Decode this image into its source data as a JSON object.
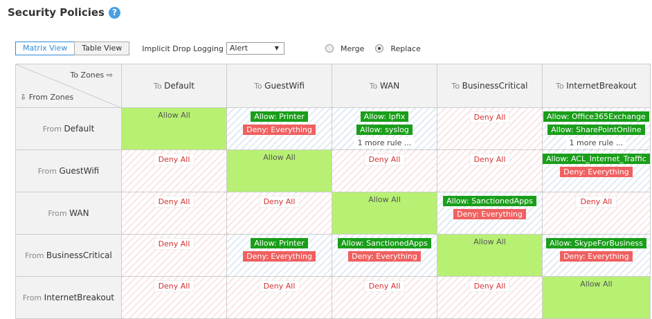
{
  "header": {
    "title": "Security Policies",
    "help_glyph": "?"
  },
  "toolbar": {
    "matrix_view": "Matrix View",
    "table_view": "Table View",
    "drop_logging_label": "Implicit Drop Logging",
    "drop_logging_value": "Alert",
    "merge_label": "Merge",
    "replace_label": "Replace",
    "selected_mode": "Replace"
  },
  "matrix": {
    "to_zones_label": "To Zones ⇨",
    "from_zones_label": "⇩  From Zones",
    "to_prefix": "To",
    "from_prefix": "From",
    "columns": [
      "Default",
      "GuestWifi",
      "WAN",
      "BusinessCritical",
      "InternetBreakout"
    ],
    "rows": [
      {
        "zone": "Default",
        "cells": [
          {
            "type": "allow-all",
            "label": "Allow All"
          },
          {
            "type": "mixed",
            "items": [
              {
                "kind": "allow",
                "text": "Allow: Printer"
              },
              {
                "kind": "deny",
                "text": "Deny: Everything"
              }
            ]
          },
          {
            "type": "mixed",
            "items": [
              {
                "kind": "allow",
                "text": "Allow: Ipfix"
              },
              {
                "kind": "allow",
                "text": "Allow: syslog"
              },
              {
                "kind": "more",
                "text": "1 more rule ..."
              }
            ]
          },
          {
            "type": "deny-all",
            "label": "Deny All"
          },
          {
            "type": "mixed",
            "items": [
              {
                "kind": "allow",
                "text": "Allow: Office365Exchange"
              },
              {
                "kind": "allow",
                "text": "Allow: SharePointOnline"
              },
              {
                "kind": "more",
                "text": "1 more rule ..."
              }
            ]
          }
        ]
      },
      {
        "zone": "GuestWifi",
        "cells": [
          {
            "type": "deny-all",
            "label": "Deny All"
          },
          {
            "type": "allow-all",
            "label": "Allow All"
          },
          {
            "type": "deny-all",
            "label": "Deny All"
          },
          {
            "type": "deny-all",
            "label": "Deny All"
          },
          {
            "type": "mixed",
            "items": [
              {
                "kind": "allow",
                "text": "Allow: ACL_Internet_Traffic"
              },
              {
                "kind": "deny",
                "text": "Deny: Everything"
              }
            ]
          }
        ]
      },
      {
        "zone": "WAN",
        "cells": [
          {
            "type": "deny-all",
            "label": "Deny All"
          },
          {
            "type": "deny-all",
            "label": "Deny All"
          },
          {
            "type": "allow-all",
            "label": "Allow All"
          },
          {
            "type": "mixed",
            "items": [
              {
                "kind": "allow",
                "text": "Allow: SanctionedApps"
              },
              {
                "kind": "deny",
                "text": "Deny: Everything"
              }
            ]
          },
          {
            "type": "deny-all",
            "label": "Deny All"
          }
        ]
      },
      {
        "zone": "BusinessCritical",
        "cells": [
          {
            "type": "deny-all",
            "label": "Deny All"
          },
          {
            "type": "mixed",
            "items": [
              {
                "kind": "allow",
                "text": "Allow: Printer"
              },
              {
                "kind": "deny",
                "text": "Deny: Everything"
              }
            ]
          },
          {
            "type": "mixed",
            "items": [
              {
                "kind": "allow",
                "text": "Allow: SanctionedApps"
              },
              {
                "kind": "deny",
                "text": "Deny: Everything"
              }
            ]
          },
          {
            "type": "allow-all",
            "label": "Allow All"
          },
          {
            "type": "mixed",
            "items": [
              {
                "kind": "allow",
                "text": "Allow: SkypeForBusiness"
              },
              {
                "kind": "deny",
                "text": "Deny: Everything"
              }
            ]
          }
        ]
      },
      {
        "zone": "InternetBreakout",
        "cells": [
          {
            "type": "deny-all",
            "label": "Deny All"
          },
          {
            "type": "deny-all",
            "label": "Deny All"
          },
          {
            "type": "deny-all",
            "label": "Deny All"
          },
          {
            "type": "deny-all",
            "label": "Deny All"
          },
          {
            "type": "allow-all",
            "label": "Allow All"
          }
        ]
      }
    ]
  },
  "colors": {
    "allow_all": "#b7f072",
    "allow_pill": "#1a9e1a",
    "deny_pill": "#f06060",
    "deny_text": "#d53030",
    "accent": "#2e8bd8"
  }
}
